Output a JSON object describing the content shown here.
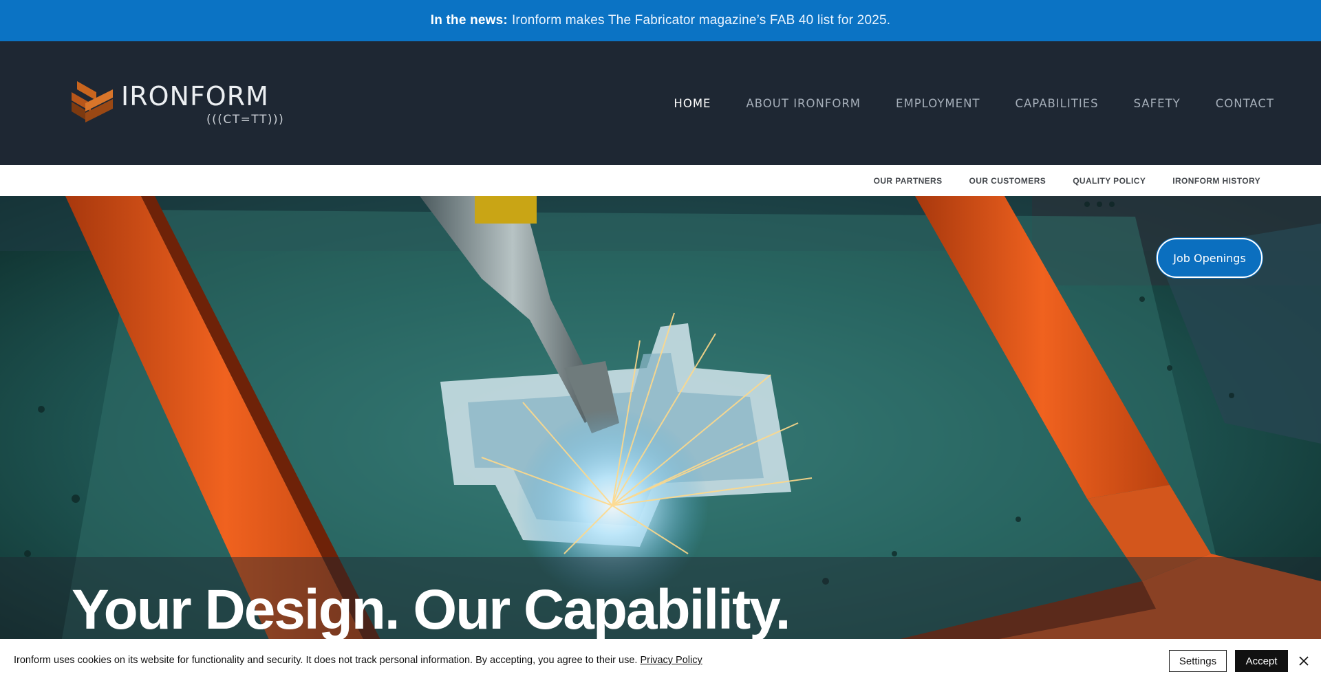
{
  "news": {
    "prefix": "In the news:",
    "text": "Ironform makes The Fabricator magazine’s FAB 40 list for 2025."
  },
  "brand": {
    "name": "IRONFORM",
    "tagline": "(((CT=TT)))",
    "logo_icon": "ironform-chevron-logo",
    "accent_color": "#0b73c4",
    "header_color": "#1e2733",
    "logo_colors": [
      "#c9651e",
      "#8a4112"
    ]
  },
  "main_nav": {
    "items": [
      {
        "label": "HOME",
        "active": true
      },
      {
        "label": "ABOUT IRONFORM",
        "active": false
      },
      {
        "label": "EMPLOYMENT",
        "active": false
      },
      {
        "label": "CAPABILITIES",
        "active": false
      },
      {
        "label": "SAFETY",
        "active": false
      },
      {
        "label": "CONTACT",
        "active": false
      }
    ]
  },
  "sub_nav": {
    "items": [
      {
        "label": "OUR PARTNERS"
      },
      {
        "label": "OUR CUSTOMERS"
      },
      {
        "label": "QUALITY POLICY"
      },
      {
        "label": "IRONFORM HISTORY"
      }
    ]
  },
  "hero": {
    "title": "Your Design. Our Capability.",
    "cta_label": "Job Openings",
    "image_subject": "robotic-welding-arm-sparks"
  },
  "cookie": {
    "text": "Ironform uses cookies on its website for functionality and security. It does not track personal information. By accepting, you agree to their use.",
    "link_label": "Privacy Policy",
    "settings_label": "Settings",
    "accept_label": "Accept",
    "close_icon": "close-icon"
  }
}
